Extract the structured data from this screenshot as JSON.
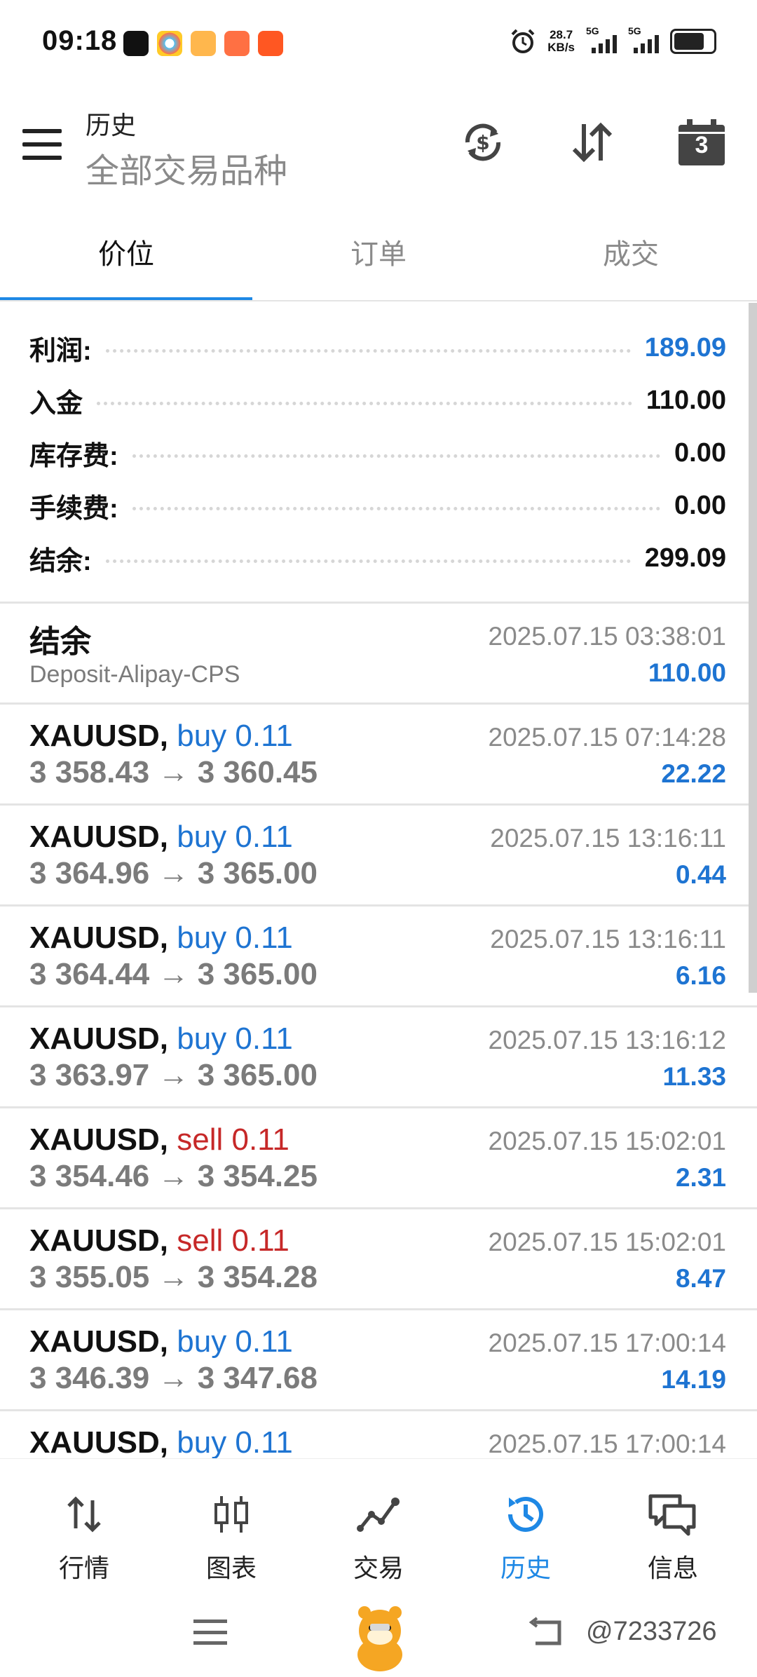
{
  "status_bar": {
    "time": "09:18",
    "net_speed_value": "28.7",
    "net_speed_unit": "KB/s",
    "signal1_label": "5G",
    "signal2_label": "5G"
  },
  "header": {
    "title": "历史",
    "subtitle": "全部交易品种",
    "icons": [
      "currency-sync-icon",
      "sort-icon",
      "calendar-icon"
    ],
    "calendar_day": "3"
  },
  "tabs": [
    {
      "label": "价位",
      "active": true
    },
    {
      "label": "订单",
      "active": false
    },
    {
      "label": "成交",
      "active": false
    }
  ],
  "summary": [
    {
      "label": "利润:",
      "value": "189.09",
      "highlight": true
    },
    {
      "label": "入金",
      "value": "110.00",
      "highlight": false
    },
    {
      "label": "库存费:",
      "value": "0.00",
      "highlight": false
    },
    {
      "label": "手续费:",
      "value": "0.00",
      "highlight": false
    },
    {
      "label": "结余:",
      "value": "299.09",
      "highlight": false
    }
  ],
  "balance_entry": {
    "title": "结余",
    "comment": "Deposit-Alipay-CPS",
    "time": "2025.07.15 03:38:01",
    "amount": "110.00"
  },
  "deals": [
    {
      "symbol": "XAUUSD,",
      "side": "buy 0.11",
      "side_type": "buy",
      "prices": "3 358.43 → 3 360.45",
      "time": "2025.07.15 07:14:28",
      "profit": "22.22"
    },
    {
      "symbol": "XAUUSD,",
      "side": "buy 0.11",
      "side_type": "buy",
      "prices": "3 364.96 → 3 365.00",
      "time": "2025.07.15 13:16:11",
      "profit": "0.44"
    },
    {
      "symbol": "XAUUSD,",
      "side": "buy 0.11",
      "side_type": "buy",
      "prices": "3 364.44 → 3 365.00",
      "time": "2025.07.15 13:16:11",
      "profit": "6.16"
    },
    {
      "symbol": "XAUUSD,",
      "side": "buy 0.11",
      "side_type": "buy",
      "prices": "3 363.97 → 3 365.00",
      "time": "2025.07.15 13:16:12",
      "profit": "11.33"
    },
    {
      "symbol": "XAUUSD,",
      "side": "sell 0.11",
      "side_type": "sell",
      "prices": "3 354.46 → 3 354.25",
      "time": "2025.07.15 15:02:01",
      "profit": "2.31"
    },
    {
      "symbol": "XAUUSD,",
      "side": "sell 0.11",
      "side_type": "sell",
      "prices": "3 355.05 → 3 354.28",
      "time": "2025.07.15 15:02:01",
      "profit": "8.47"
    },
    {
      "symbol": "XAUUSD,",
      "side": "buy 0.11",
      "side_type": "buy",
      "prices": "3 346.39 → 3 347.68",
      "time": "2025.07.15 17:00:14",
      "profit": "14.19"
    },
    {
      "symbol": "XAUUSD,",
      "side": "buy 0.11",
      "side_type": "buy",
      "prices": "",
      "time": "2025.07.15 17:00:14",
      "profit": ""
    }
  ],
  "bottom_nav": [
    {
      "label": "行情",
      "icon": "quotes-icon",
      "active": false
    },
    {
      "label": "图表",
      "icon": "chart-icon",
      "active": false
    },
    {
      "label": "交易",
      "icon": "trade-icon",
      "active": false
    },
    {
      "label": "历史",
      "icon": "history-icon",
      "active": true
    },
    {
      "label": "信息",
      "icon": "messages-icon",
      "active": false
    }
  ],
  "watermark": "@7233726",
  "colors": {
    "accent": "#1e88e5",
    "profit_blue": "#1e74d2",
    "sell_red": "#c62828",
    "muted_gray": "#8a8a8a"
  }
}
